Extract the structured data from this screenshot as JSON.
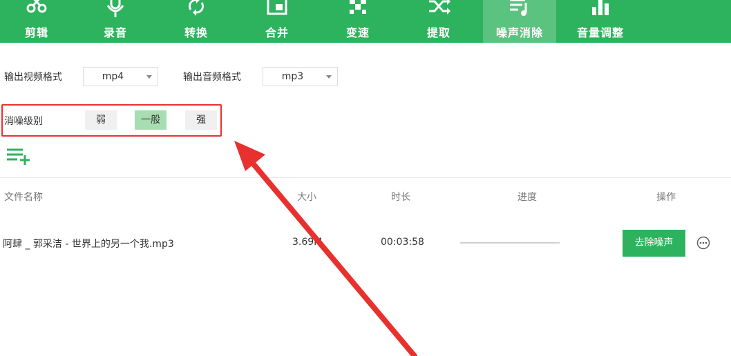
{
  "toolbar": {
    "items": [
      {
        "label": "剪辑",
        "icon": "scissors-icon"
      },
      {
        "label": "录音",
        "icon": "microphone-icon"
      },
      {
        "label": "转换",
        "icon": "convert-icon"
      },
      {
        "label": "合并",
        "icon": "merge-icon"
      },
      {
        "label": "变速",
        "icon": "speed-icon"
      },
      {
        "label": "提取",
        "icon": "extract-icon"
      },
      {
        "label": "噪声消除",
        "icon": "noise-reduction-icon"
      },
      {
        "label": "音量调整",
        "icon": "volume-icon"
      }
    ],
    "active_index": 6
  },
  "settings": {
    "video_format_label": "输出视频格式",
    "video_format_value": "mp4",
    "audio_format_label": "输出音频格式",
    "audio_format_value": "mp3",
    "noise_level_label": "消噪级别",
    "levels": [
      "弱",
      "一般",
      "强"
    ],
    "selected_level": "一般"
  },
  "table": {
    "headers": [
      "文件名称",
      "大小",
      "时长",
      "进度",
      "操作"
    ],
    "rows": [
      {
        "name": "阿肆 _ 郭采洁 - 世界上的另一个我.mp3",
        "size": "3.69M",
        "duration": "00:03:58",
        "progress": 0,
        "action": "去除噪声"
      }
    ]
  },
  "colors": {
    "brand": "#2db35d",
    "selected_level": "#a8ddb2",
    "annotation": "#e8312e"
  }
}
